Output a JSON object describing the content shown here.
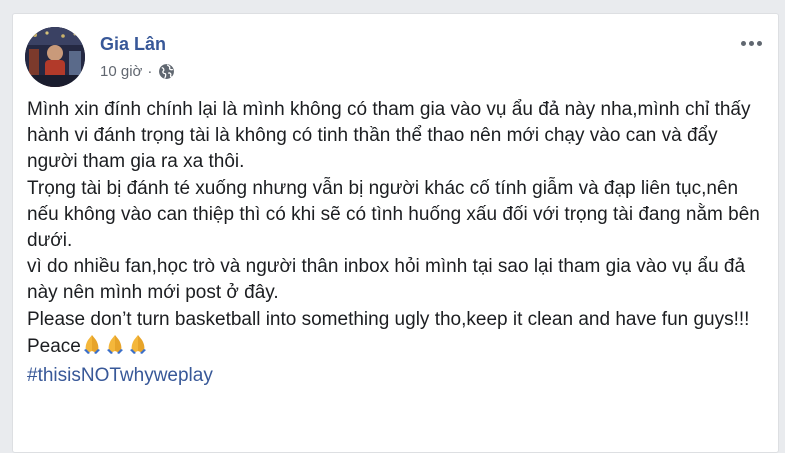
{
  "post": {
    "author": "Gia Lân",
    "time": "10 giờ",
    "separator": "·",
    "privacy_icon": "globe-icon",
    "more_icon": "more-options-icon",
    "paragraphs": [
      "Mình xin đính chính lại là mình không có tham gia vào vụ ẩu đả này nha,mình chỉ thấy hành vi đánh trọng tài là không có tinh thần thể thao nên mới chạy vào can và đẩy người tham gia ra xa thôi.",
      "Trọng tài bị đánh té xuống nhưng vẫn bị người khác cố tính giẫm và đạp liên tục,nên nếu không vào can thiệp thì có khi sẽ có tình huống xấu đối với trọng tài đang nằm bên dưới.",
      "vì do nhiều fan,học trò và người thân inbox hỏi mình tại sao lại tham gia vào vụ ẩu đả này nên mình mới post ở đây.",
      "Please don’t turn basketball into something ugly tho,keep it clean and have fun guys!!!"
    ],
    "closing": "Peace",
    "closing_emoji": "folded-hands-icon",
    "hashtag": "#thisisNOTwhyweplay",
    "colors": {
      "link": "#385898",
      "text": "#1c1e21",
      "meta": "#616770",
      "background": "#e9ebee"
    }
  }
}
